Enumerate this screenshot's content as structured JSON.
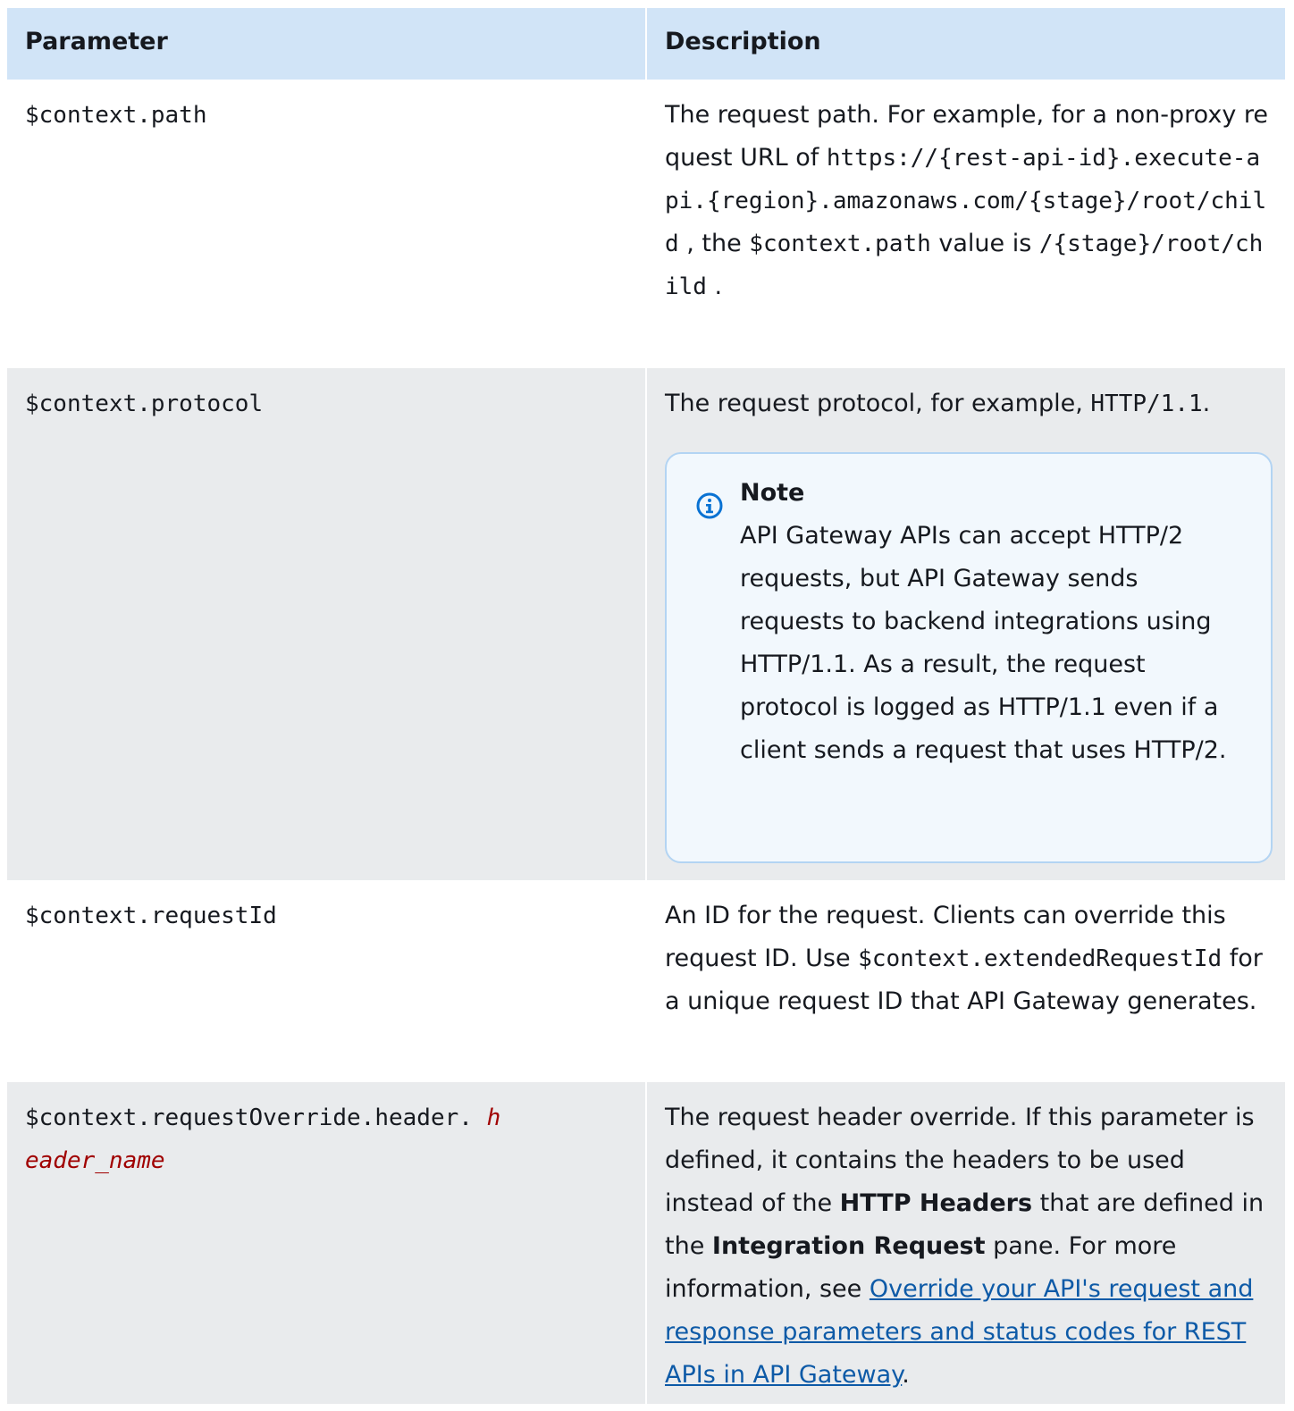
{
  "header": {
    "col1": "Parameter",
    "col2": "Description"
  },
  "rows": [
    {
      "param": "$context.path",
      "desc": {
        "t1": "The request path. For example, for a non-proxy request URL of ",
        "code1": "https://{rest-api-id}.execute-api.{region}.amazonaws.com/{stage}/root/child",
        "t2": " , the ",
        "code2": "$context.path",
        "t3": " value is ",
        "code3": "/{stage}/root/child",
        "t4": " ."
      }
    },
    {
      "param": "$context.protocol",
      "desc": {
        "t1": "The request protocol, for example, ",
        "code1": "HTTP/1.1",
        "t2": "."
      },
      "note": {
        "title": "Note",
        "body": "API Gateway APIs can accept HTTP/2 requests, but API Gateway sends requests to backend integrations using HTTP/1.1. As a result, the request protocol is logged as HTTP/1.1 even if a client sends a request that uses HTTP/2."
      }
    },
    {
      "param": "$context.requestId",
      "desc": {
        "t1": "An ID for the request. Clients can override this request ID. Use ",
        "code1": "$context.extendedRequestId",
        "t2": " for a unique request ID that API Gateway generates."
      }
    },
    {
      "param": "$context.requestOverride.header.",
      "param_italic": "header_name",
      "desc": {
        "t1": "The request header override. If this parameter is defined, it contains the headers to be used instead of the ",
        "b1": "HTTP Headers",
        "t2": " that are defined in the ",
        "b2": "Integration Request",
        "t3": " pane. For more information, see ",
        "link": "Override your API's request and response parameters and status codes for REST APIs in API Gateway",
        "t4": "."
      }
    }
  ],
  "colors": {
    "header_bg": "#d1e4f7",
    "stripe_bg": "#e9ebed",
    "note_bg": "#f2f8fd",
    "link": "#0d5aa7",
    "italic_param": "#a00000"
  },
  "icons": {
    "note_icon": "info-icon"
  }
}
